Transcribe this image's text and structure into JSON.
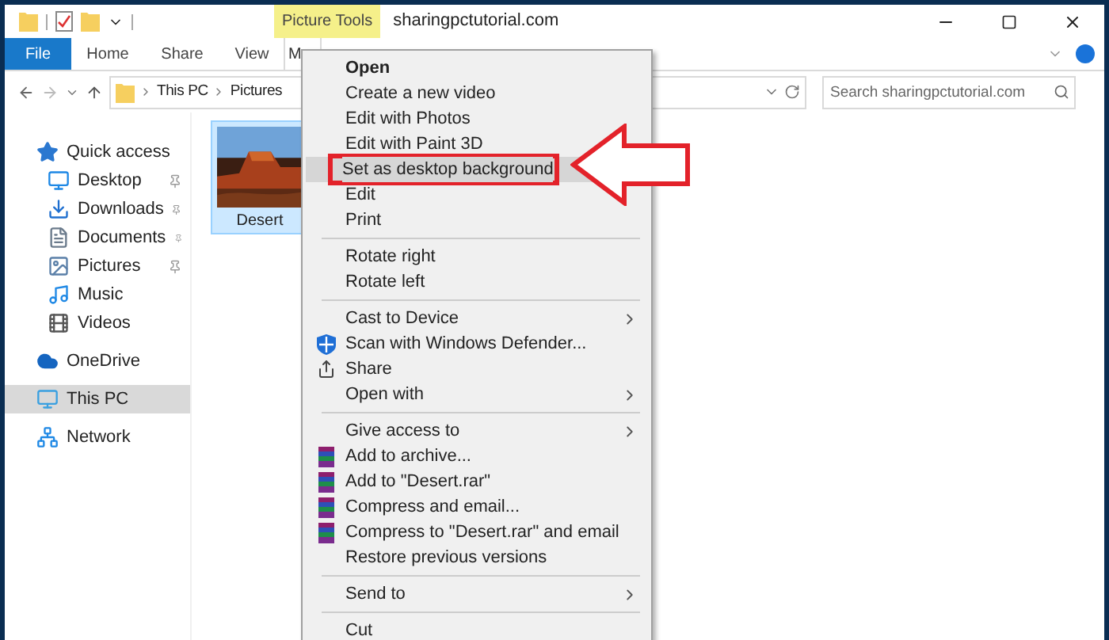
{
  "window": {
    "title": "sharingpctutorial.com",
    "context_tab": "Picture Tools"
  },
  "ribbon_tabs": [
    {
      "label": "File",
      "kind": "file",
      "selected": false
    },
    {
      "label": "Home",
      "kind": "tab",
      "selected": false
    },
    {
      "label": "Share",
      "kind": "tab",
      "selected": false
    },
    {
      "label": "View",
      "kind": "tab",
      "selected": false
    },
    {
      "label": "M",
      "kind": "context",
      "selected": true
    }
  ],
  "address": {
    "segments": [
      "This PC",
      "Pictures"
    ]
  },
  "search": {
    "placeholder": "Search sharingpctutorial.com"
  },
  "nav": [
    {
      "label": "Quick access",
      "selected": false,
      "children": [
        {
          "label": "Desktop",
          "pinned": true
        },
        {
          "label": "Downloads",
          "pinned": true
        },
        {
          "label": "Documents",
          "pinned": true
        },
        {
          "label": "Pictures",
          "pinned": true
        },
        {
          "label": "Music",
          "pinned": false
        },
        {
          "label": "Videos",
          "pinned": false
        }
      ]
    },
    {
      "label": "OneDrive",
      "selected": false
    },
    {
      "label": "This PC",
      "selected": true
    },
    {
      "label": "Network",
      "selected": false
    }
  ],
  "files": [
    {
      "name": "Desert",
      "kind": "picture",
      "selected": true
    }
  ],
  "context_menu": [
    {
      "kind": "item",
      "label": "Open",
      "bold": true
    },
    {
      "kind": "item",
      "label": "Create a new video"
    },
    {
      "kind": "item",
      "label": "Edit with Photos"
    },
    {
      "kind": "item",
      "label": "Edit with Paint 3D"
    },
    {
      "kind": "item",
      "label": "Set as desktop background",
      "selected": true
    },
    {
      "kind": "item",
      "label": "Edit"
    },
    {
      "kind": "item",
      "label": "Print"
    },
    {
      "kind": "separator"
    },
    {
      "kind": "item",
      "label": "Rotate right"
    },
    {
      "kind": "item",
      "label": "Rotate left"
    },
    {
      "kind": "separator"
    },
    {
      "kind": "item",
      "label": "Cast to Device",
      "submenu": true
    },
    {
      "kind": "defender",
      "label": "Scan with Windows Defender..."
    },
    {
      "kind": "share",
      "label": "Share"
    },
    {
      "kind": "item",
      "label": "Open with",
      "submenu": true
    },
    {
      "kind": "separator"
    },
    {
      "kind": "item",
      "label": "Give access to",
      "submenu": true
    },
    {
      "kind": "archive",
      "label": "Add to archive..."
    },
    {
      "kind": "archive",
      "label": "Add to \"Desert.rar\""
    },
    {
      "kind": "archive",
      "label": "Compress and email..."
    },
    {
      "kind": "archive",
      "label": "Compress to \"Desert.rar\" and email"
    },
    {
      "kind": "item",
      "label": "Restore previous versions"
    },
    {
      "kind": "separator"
    },
    {
      "kind": "item",
      "label": "Send to",
      "submenu": true
    },
    {
      "kind": "separator"
    },
    {
      "kind": "item",
      "label": "Cut"
    }
  ]
}
